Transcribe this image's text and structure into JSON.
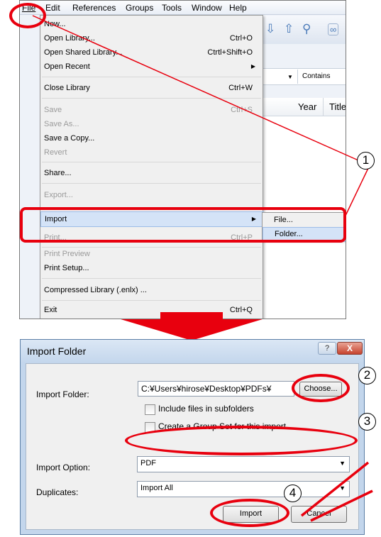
{
  "menubar": {
    "file": "File",
    "edit": "Edit",
    "references": "References",
    "groups": "Groups",
    "tools": "Tools",
    "window": "Window",
    "help": "Help"
  },
  "background": {
    "search_option": "Contains",
    "col_year": "Year",
    "col_title": "Title"
  },
  "file_menu": {
    "new": "New...",
    "open_library": "Open Library...",
    "open_library_sc": "Ctrl+O",
    "open_shared": "Open Shared Library...",
    "open_shared_sc": "Ctrtl+Shift+O",
    "open_recent": "Open Recent",
    "close_library": "Close Library",
    "close_library_sc": "Ctrl+W",
    "save": "Save",
    "save_sc": "Ctrl+S",
    "save_as": "Save As...",
    "save_copy": "Save a Copy...",
    "revert": "Revert",
    "share": "Share...",
    "export": "Export...",
    "import": "Import",
    "print": "Print...",
    "print_sc": "Ctrl+P",
    "print_preview": "Print Preview",
    "print_setup": "Print Setup...",
    "compressed": "Compressed Library (.enlx) ...",
    "exit": "Exit",
    "exit_sc": "Ctrl+Q"
  },
  "import_submenu": {
    "file": "File...",
    "folder": "Folder..."
  },
  "dialog": {
    "title": "Import Folder",
    "help": "?",
    "close": "X",
    "import_folder_label": "Import Folder:",
    "folder_path": "C:¥Users¥hirose¥Desktop¥PDFs¥",
    "choose": "Choose...",
    "include_subfolders": "Include files in subfolders",
    "create_group_set": "Create a Group Set for this import",
    "import_option_label": "Import Option:",
    "import_option_value": "PDF",
    "duplicates_label": "Duplicates:",
    "duplicates_value": "Import All",
    "import_button": "Import",
    "cancel_button": "Cancel"
  },
  "steps": {
    "s1": "1",
    "s2": "2",
    "s3": "3",
    "s4": "4"
  },
  "colors": {
    "annotation_red": "#e8000e",
    "menu_highlight": "#d4e3f7"
  },
  "icons": [
    "download-icon",
    "upload-icon",
    "find-icon",
    "link-icon",
    "submenu-arrow-icon",
    "dropdown-arrow-icon",
    "down-arrow-icon"
  ]
}
